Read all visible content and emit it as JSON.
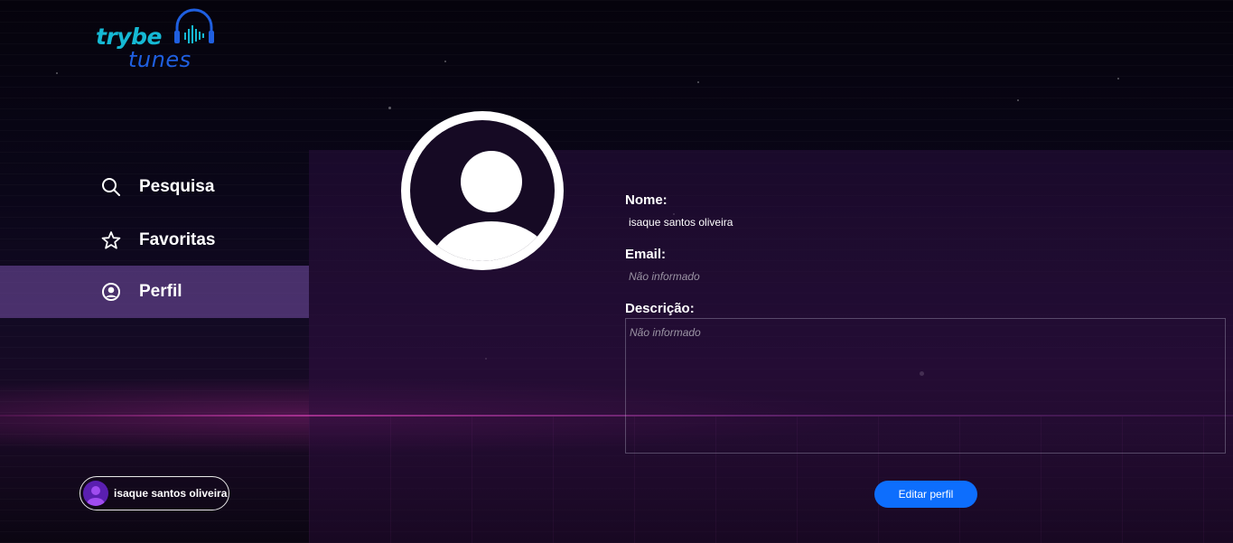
{
  "app": {
    "logo_top": "trybe",
    "logo_bottom": "tunes"
  },
  "sidebar": {
    "items": [
      {
        "label": "Pesquisa",
        "icon": "search-icon",
        "active": false
      },
      {
        "label": "Favoritas",
        "icon": "star-icon",
        "active": false
      },
      {
        "label": "Perfil",
        "icon": "user-circle-icon",
        "active": true
      }
    ],
    "user": {
      "name": "isaque santos oliveira",
      "icon": "user-avatar-icon"
    }
  },
  "profile": {
    "name_label": "Nome:",
    "name_value": "isaque santos oliveira",
    "email_label": "Email:",
    "email_value": "Não informado",
    "description_label": "Descrição:",
    "description_value": "Não informado",
    "edit_button": "Editar perfil"
  },
  "colors": {
    "accent": "#0d6efd",
    "active_nav": "#6a4a94",
    "logo_cyan": "#15b9d4",
    "logo_blue": "#1f5fe0"
  }
}
